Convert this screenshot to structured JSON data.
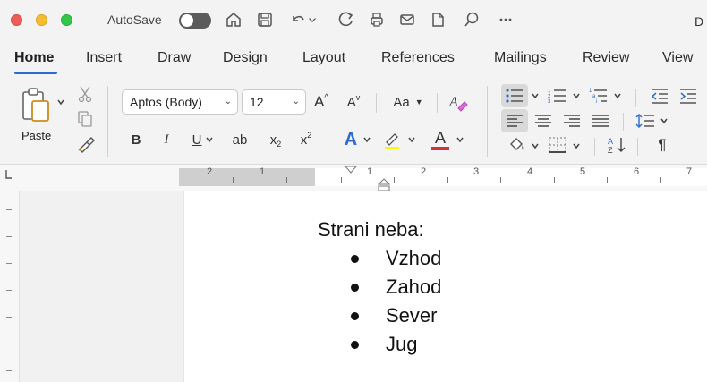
{
  "titlebar": {
    "autosave_label": "AutoSave",
    "document_title_fragment": "D"
  },
  "tabs": [
    {
      "label": "Home",
      "active": true
    },
    {
      "label": "Insert"
    },
    {
      "label": "Draw"
    },
    {
      "label": "Design"
    },
    {
      "label": "Layout"
    },
    {
      "label": "References"
    },
    {
      "label": "Mailings"
    },
    {
      "label": "Review"
    },
    {
      "label": "View"
    }
  ],
  "ribbon": {
    "paste_label": "Paste",
    "font_name": "Aptos (Body)",
    "font_size": "12",
    "change_case_label": "Aa",
    "bold": "B",
    "italic": "I",
    "underline": "U",
    "strikethrough": "ab",
    "subscript": "x",
    "superscript": "x",
    "grow_font": "A",
    "shrink_font": "A",
    "text_effects": "A",
    "font_color": "A",
    "pilcrow": "¶"
  },
  "ruler": {
    "numbers": [
      "2",
      "1",
      "1",
      "2",
      "3",
      "4",
      "5",
      "6",
      "7"
    ]
  },
  "document": {
    "heading": "Strani neba:",
    "bullets": [
      "Vzhod",
      "Zahod",
      "Sever",
      "Jug"
    ]
  },
  "colors": {
    "accent": "#2b6bd1",
    "ribbon_bg": "#f3f3f3",
    "highlight_pink": "#b146c2",
    "font_color_red": "#d13438"
  }
}
